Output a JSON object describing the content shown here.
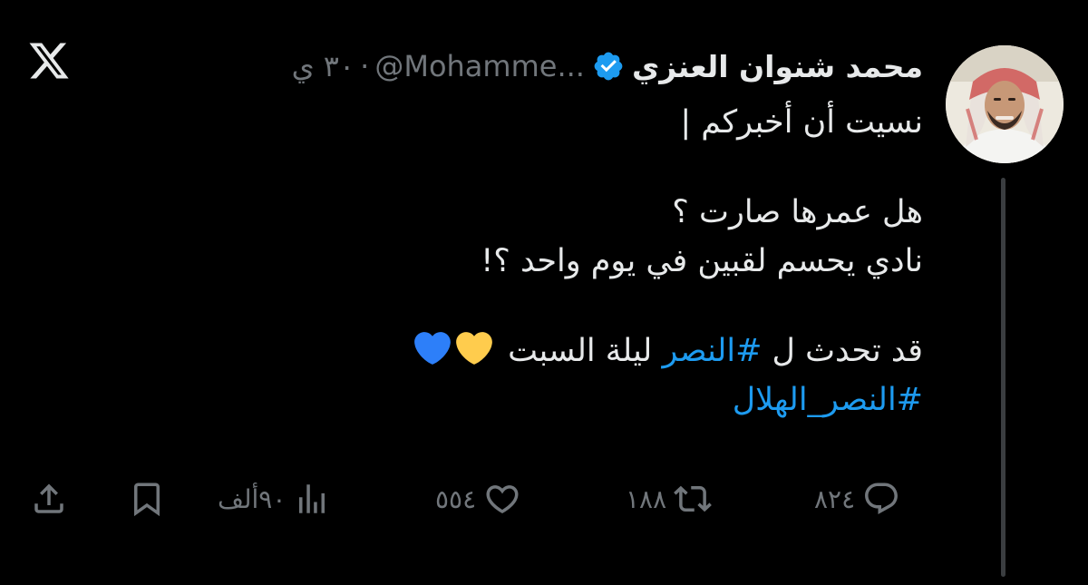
{
  "tweet": {
    "display_name": "محمد شنوان العنزي",
    "handle": "@Mohamme...",
    "separator": "·",
    "time": "٣٠ ي",
    "lines": [
      "نسيت أن أخبركم |",
      "هل عمرها صارت ؟",
      "نادي يحسم لقبين في يوم واحد ؟!"
    ],
    "final_line_prefix": "قد تحدث ل ",
    "final_line_hashtag": "#النصر",
    "final_line_suffix": " ليلة السبت ",
    "hashtag_line": "#النصر_الهلال",
    "hearts": [
      "yellow-heart",
      "blue-heart"
    ]
  },
  "actions": {
    "replies": "٨٢٤",
    "reposts": "١٨٨",
    "likes": "٥٥٤",
    "views": "٩٠ألف"
  },
  "icons": {
    "logo": "x-logo-icon",
    "verified": "verified-badge-icon",
    "reply": "reply-icon",
    "repost": "repost-icon",
    "like": "heart-icon",
    "views": "views-chart-icon",
    "bookmark": "bookmark-icon",
    "share": "share-icon"
  },
  "colors": {
    "background": "#000000",
    "text": "#e7e9ea",
    "muted": "#71767b",
    "link": "#1d9bf0",
    "verified": "#1d9bf0",
    "heart_yellow": "#ffcc4d",
    "heart_blue": "#2d7ff9"
  }
}
